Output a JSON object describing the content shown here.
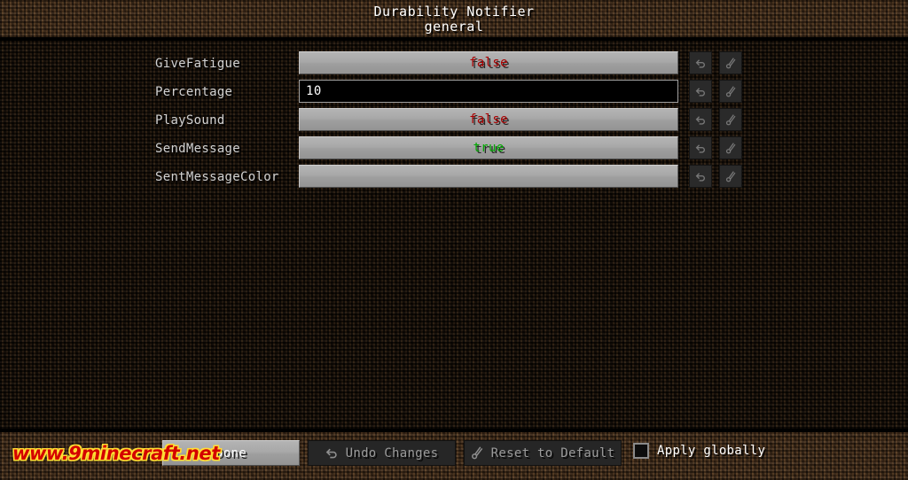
{
  "header": {
    "title": "Durability Notifier",
    "subtitle": "general"
  },
  "options": [
    {
      "label": "GiveFatigue",
      "widget": "button",
      "value": "false",
      "value_kind": "false",
      "undo_icon": "undo-arrow-icon",
      "reset_icon": "reset-wrench-icon"
    },
    {
      "label": "Percentage",
      "widget": "field",
      "value": "10",
      "value_kind": "number",
      "undo_icon": "undo-arrow-icon",
      "reset_icon": "reset-wrench-icon"
    },
    {
      "label": "PlaySound",
      "widget": "button",
      "value": "false",
      "value_kind": "false",
      "undo_icon": "undo-arrow-icon",
      "reset_icon": "reset-wrench-icon"
    },
    {
      "label": "SendMessage",
      "widget": "button",
      "value": "true",
      "value_kind": "true",
      "undo_icon": "undo-arrow-icon",
      "reset_icon": "reset-wrench-icon"
    },
    {
      "label": "SentMessageColor",
      "widget": "button",
      "value": "",
      "value_kind": "empty",
      "undo_icon": "undo-arrow-icon",
      "reset_icon": "reset-wrench-icon"
    }
  ],
  "footer": {
    "done_label": "Done",
    "undo_changes_label": "Undo Changes",
    "reset_default_label": "Reset to Default",
    "apply_globally_label": "Apply globally",
    "apply_globally_checked": false
  },
  "watermark": {
    "text": "www.9minecraft.net"
  },
  "colors": {
    "value_false": "#aa0000",
    "value_true": "#00aa00",
    "label_text": "#d2d2d2",
    "title_text": "#ffffff",
    "watermark_fill": "#d40000",
    "watermark_outline": "#ffdd33"
  }
}
